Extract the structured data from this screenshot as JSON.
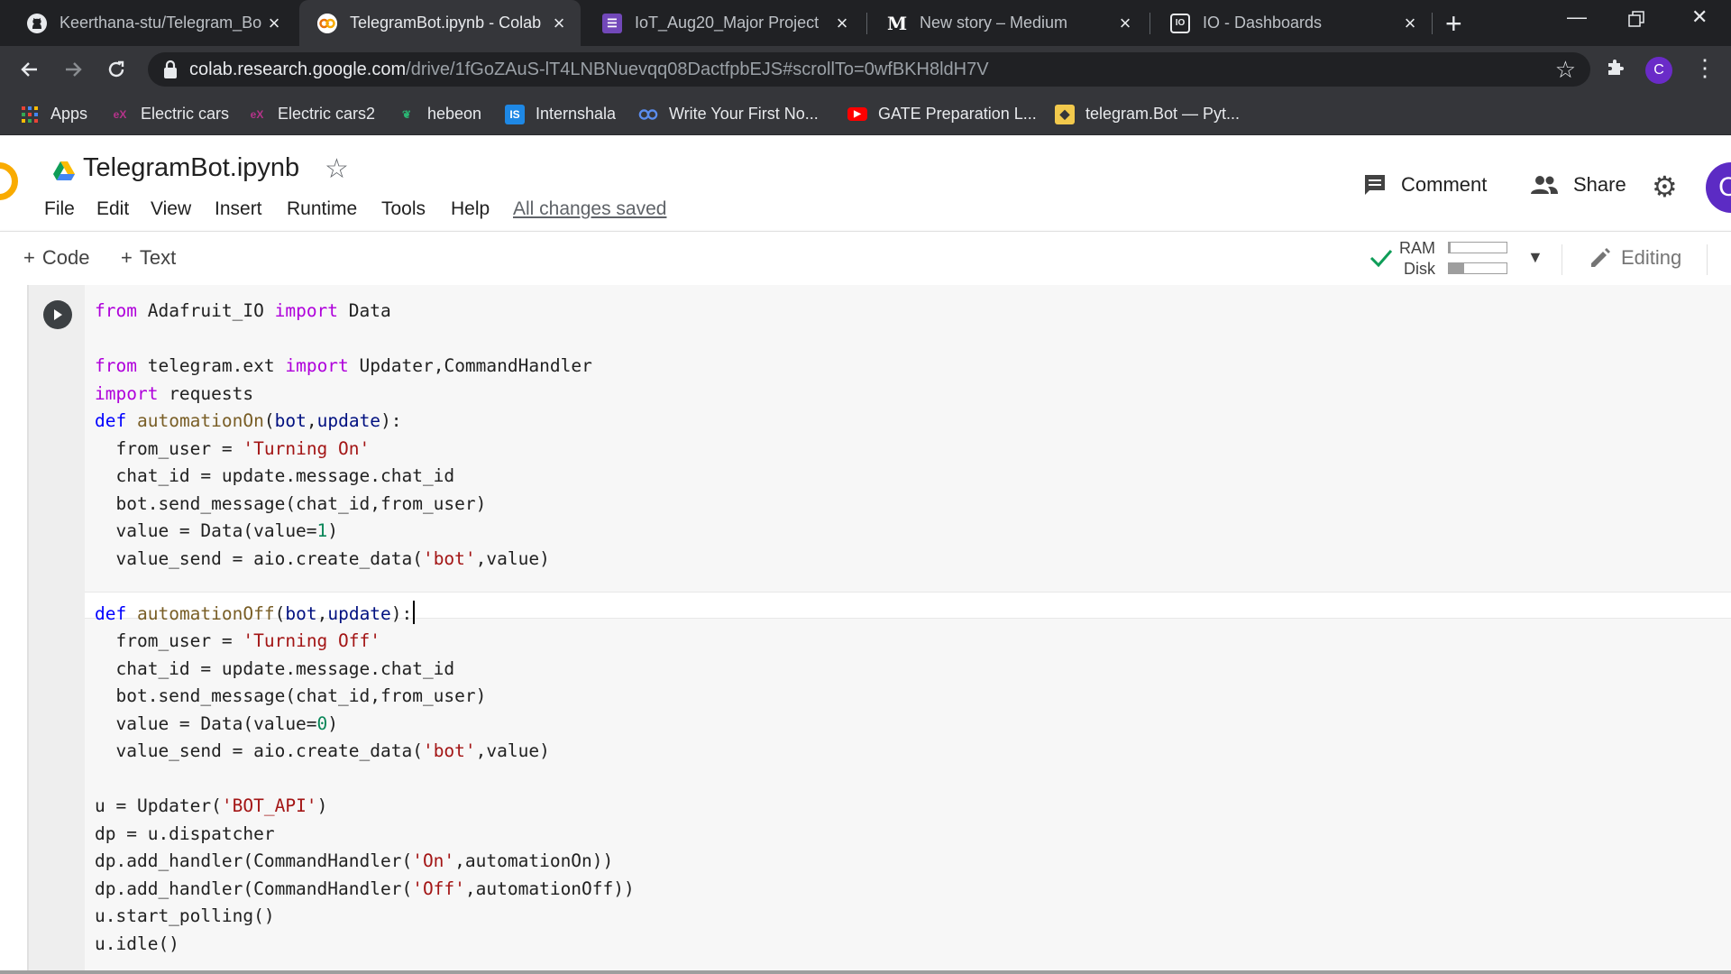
{
  "browser": {
    "tabs": [
      {
        "title": "Keerthana-stu/Telegram_Bo",
        "icon": "github-icon"
      },
      {
        "title": "TelegramBot.ipynb - Colab",
        "icon": "colab-icon",
        "active": true
      },
      {
        "title": "IoT_Aug20_Major Project",
        "icon": "forms-icon"
      },
      {
        "title": "New story – Medium",
        "icon": "medium-icon"
      },
      {
        "title": "IO - Dashboards",
        "icon": "adafruit-io-icon"
      }
    ],
    "url_host": "colab.research.google.com",
    "url_path": "/drive/1fGoZAuS-lT4LNBNuevqq08DactfpbEJS#scrollTo=0wfBKH8ldH7V",
    "profile_initial": "C",
    "bookmarks": [
      {
        "label": "Apps",
        "icon": "apps-grid-icon"
      },
      {
        "label": "Electric cars",
        "icon": "edx-icon"
      },
      {
        "label": "Electric cars2",
        "icon": "edx-icon"
      },
      {
        "label": "hebeon",
        "icon": "hebeon-icon"
      },
      {
        "label": "Internshala",
        "icon": "internshala-icon"
      },
      {
        "label": "Write Your First No...",
        "icon": "colab-icon"
      },
      {
        "label": "GATE Preparation L...",
        "icon": "youtube-icon"
      },
      {
        "label": "telegram.Bot — Pyt...",
        "icon": "python-icon"
      }
    ]
  },
  "colab": {
    "notebook_title": "TelegramBot.ipynb",
    "menu": [
      "File",
      "Edit",
      "View",
      "Insert",
      "Runtime",
      "Tools",
      "Help"
    ],
    "save_status": "All changes saved",
    "comment_label": "Comment",
    "share_label": "Share",
    "profile_initial": "C",
    "add_code_label": "Code",
    "add_text_label": "Text",
    "ram_label": "RAM",
    "disk_label": "Disk",
    "ram_usage_fraction": 0.03,
    "disk_usage_fraction": 0.27,
    "editing_label": "Editing"
  },
  "cell": {
    "lines": [
      "from Adafruit_IO import Data",
      "",
      "from telegram.ext import Updater,CommandHandler",
      "import requests",
      "def automationOn(bot,update):",
      "  from_user = 'Turning On'",
      "  chat_id = update.message.chat_id",
      "  bot.send_message(chat_id,from_user)",
      "  value = Data(value=1)",
      "  value_send = aio.create_data('bot',value)",
      "",
      "def automationOff(bot,update):",
      "  from_user = 'Turning Off'",
      "  chat_id = update.message.chat_id",
      "  bot.send_message(chat_id,from_user)",
      "  value = Data(value=0)",
      "  value_send = aio.create_data('bot',value)",
      "",
      "u = Updater('BOT_API')",
      "dp = u.dispatcher",
      "dp.add_handler(CommandHandler('On',automationOn))",
      "dp.add_handler(CommandHandler('Off',automationOff))",
      "u.start_polling()",
      "u.idle()"
    ],
    "cursor_line": 11
  },
  "colors": {
    "keyword": "#af00db",
    "def_keyword": "#0000ff",
    "function": "#795e26",
    "param": "#001080",
    "string": "#a31515",
    "number": "#098658",
    "accent_purple": "#5c2bc4",
    "colab_orange": "#f9ab00"
  }
}
